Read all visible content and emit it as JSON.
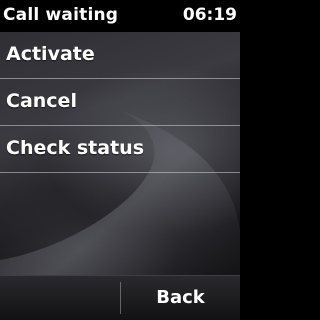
{
  "status_bar": {
    "title": "Call waiting",
    "time": "06:19"
  },
  "menu": {
    "items": [
      {
        "label": "Activate"
      },
      {
        "label": "Cancel"
      },
      {
        "label": "Check status"
      }
    ]
  },
  "softkeys": {
    "left_label": "",
    "right_label": "Back"
  }
}
